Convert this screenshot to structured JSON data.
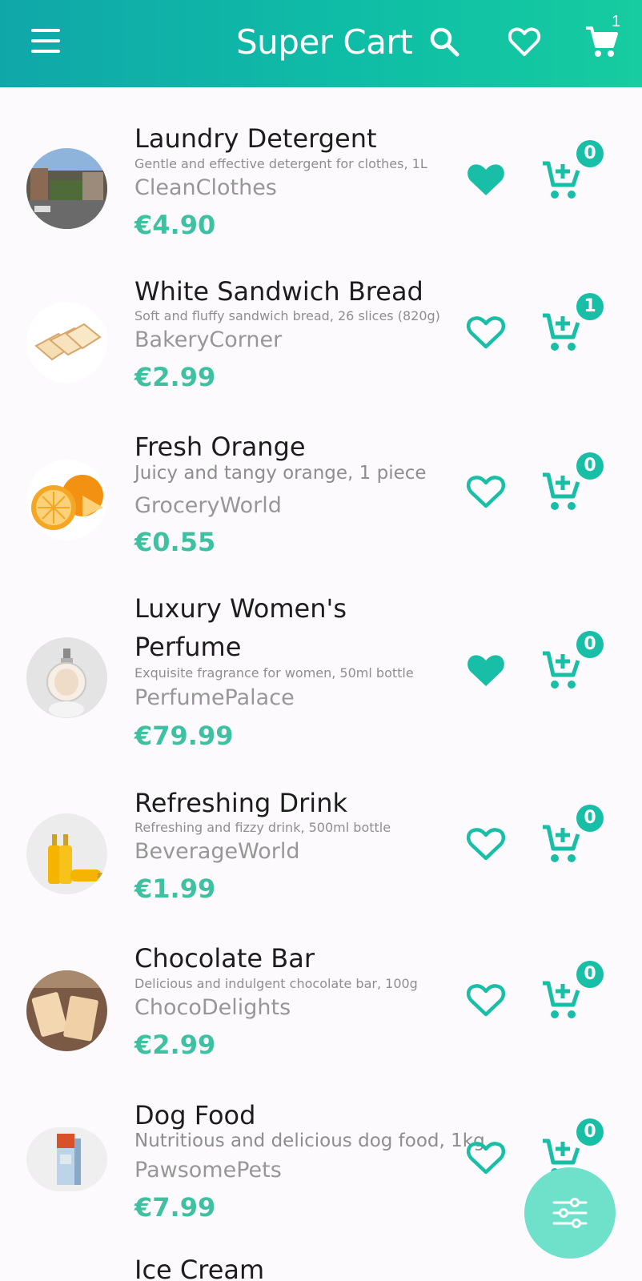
{
  "appbar": {
    "title": "Super Cart",
    "cart_count": "1",
    "icons": [
      "menu-icon",
      "search-icon",
      "heart-icon",
      "shopping-cart-icon"
    ]
  },
  "products": [
    {
      "name": "Laundry Detergent",
      "description": "Gentle and effective detergent for clothes, 1L",
      "brand": "CleanClothes",
      "price": "€4.90",
      "favorite": true,
      "cart_qty": "0"
    },
    {
      "name": "White Sandwich Bread",
      "description": "Soft and fluffy sandwich bread, 26 slices (820g)",
      "brand": "BakeryCorner",
      "price": "€2.99",
      "favorite": false,
      "cart_qty": "1"
    },
    {
      "name": "Fresh Orange",
      "description": "Juicy and tangy orange, 1 piece",
      "brand": "GroceryWorld",
      "price": "€0.55",
      "favorite": false,
      "cart_qty": "0"
    },
    {
      "name": "Luxury Women's Perfume",
      "description": "Exquisite fragrance for women, 50ml bottle",
      "brand": "PerfumePalace",
      "price": "€79.99",
      "favorite": true,
      "cart_qty": "0"
    },
    {
      "name": "Refreshing Drink",
      "description": "Refreshing and fizzy drink, 500ml bottle",
      "brand": "BeverageWorld",
      "price": "€1.99",
      "favorite": false,
      "cart_qty": "0"
    },
    {
      "name": "Chocolate Bar",
      "description": "Delicious and indulgent chocolate bar, 100g",
      "brand": "ChocoDelights",
      "price": "€2.99",
      "favorite": false,
      "cart_qty": "0"
    },
    {
      "name": "Dog Food",
      "description": "Nutritious and delicious dog food, 1kg",
      "brand": "PawsomePets",
      "price": "€7.99",
      "favorite": false,
      "cart_qty": "0"
    },
    {
      "name": "Ice Cream"
    }
  ],
  "fab": {
    "icon": "filter-sliders-icon"
  },
  "colors": {
    "accent": "#18bfa6",
    "price": "#3ec1a1",
    "appbar_start": "#10a7a9",
    "appbar_end": "#16cca0",
    "fab": "#6fe1cb"
  }
}
